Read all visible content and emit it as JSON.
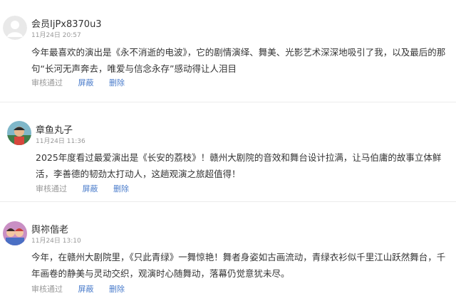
{
  "comments": [
    {
      "username": "会员IjPx8370u3",
      "time": "11月24日 20:57",
      "content": "今年最喜欢的演出是《永不消逝的电波》，它的剧情演绎、舞美、光影艺术深深地吸引了我，以及最后的那句“长河无声奔去，唯爱与信念永存”感动得让人泪目",
      "status": "审核通过",
      "hide": "屏蔽",
      "delete": "删除",
      "avatar": "default-avatar"
    },
    {
      "username": "章鱼丸子",
      "time": "11月24日 11:36",
      "content": "2025年度看过最爱演出是《长安的荔枝》！赣州大剧院的音效和舞台设计拉满，让马伯庸的故事立体鲜活，李善德的韧劲太打动人，这趟观演之旅超值得！",
      "status": "审核通过",
      "hide": "屏蔽",
      "delete": "删除",
      "avatar": "photo-avatar"
    },
    {
      "username": "舆祢偕老",
      "time": "11月24日 13:10",
      "content": "今年，在赣州大剧院里，《只此青绿》一舞惊艳！舞者身姿如古画流动，青绿衣衫似千里江山跃然舞台，千年画卷的静美与灵动交织，观演时心随舞动，落幕仍觉意犹未尽。",
      "status": "审核通过",
      "hide": "屏蔽",
      "delete": "删除",
      "avatar": "photo-avatar"
    }
  ]
}
